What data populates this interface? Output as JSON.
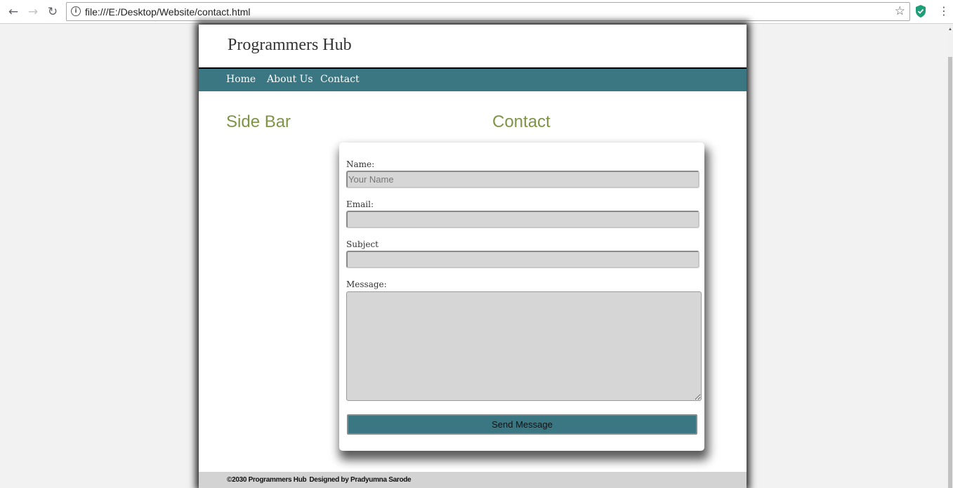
{
  "browser": {
    "url": "file:///E:/Desktop/Website/contact.html",
    "icons": {
      "back": "back-arrow-icon",
      "forward": "forward-arrow-icon",
      "reload": "reload-icon",
      "info": "info-icon",
      "star": "star-icon",
      "extension": "shield-icon",
      "menu": "kebab-menu-icon"
    }
  },
  "site": {
    "title": "Programmers Hub",
    "nav": [
      "Home",
      "About Us",
      "Contact"
    ],
    "accent_color": "#3b7683",
    "heading_color": "#7e9545"
  },
  "sidebar": {
    "title": "Side Bar"
  },
  "contact": {
    "title": "Contact",
    "form": {
      "name_label": "Name:",
      "name_placeholder": "Your Name",
      "email_label": "Email:",
      "subject_label": "Subject",
      "message_label": "Message:",
      "submit_label": "Send Message"
    }
  },
  "footer": {
    "copyright": "©2030 Programmers Hub",
    "designed_by": "Designed by Pradyumna Sarode"
  }
}
